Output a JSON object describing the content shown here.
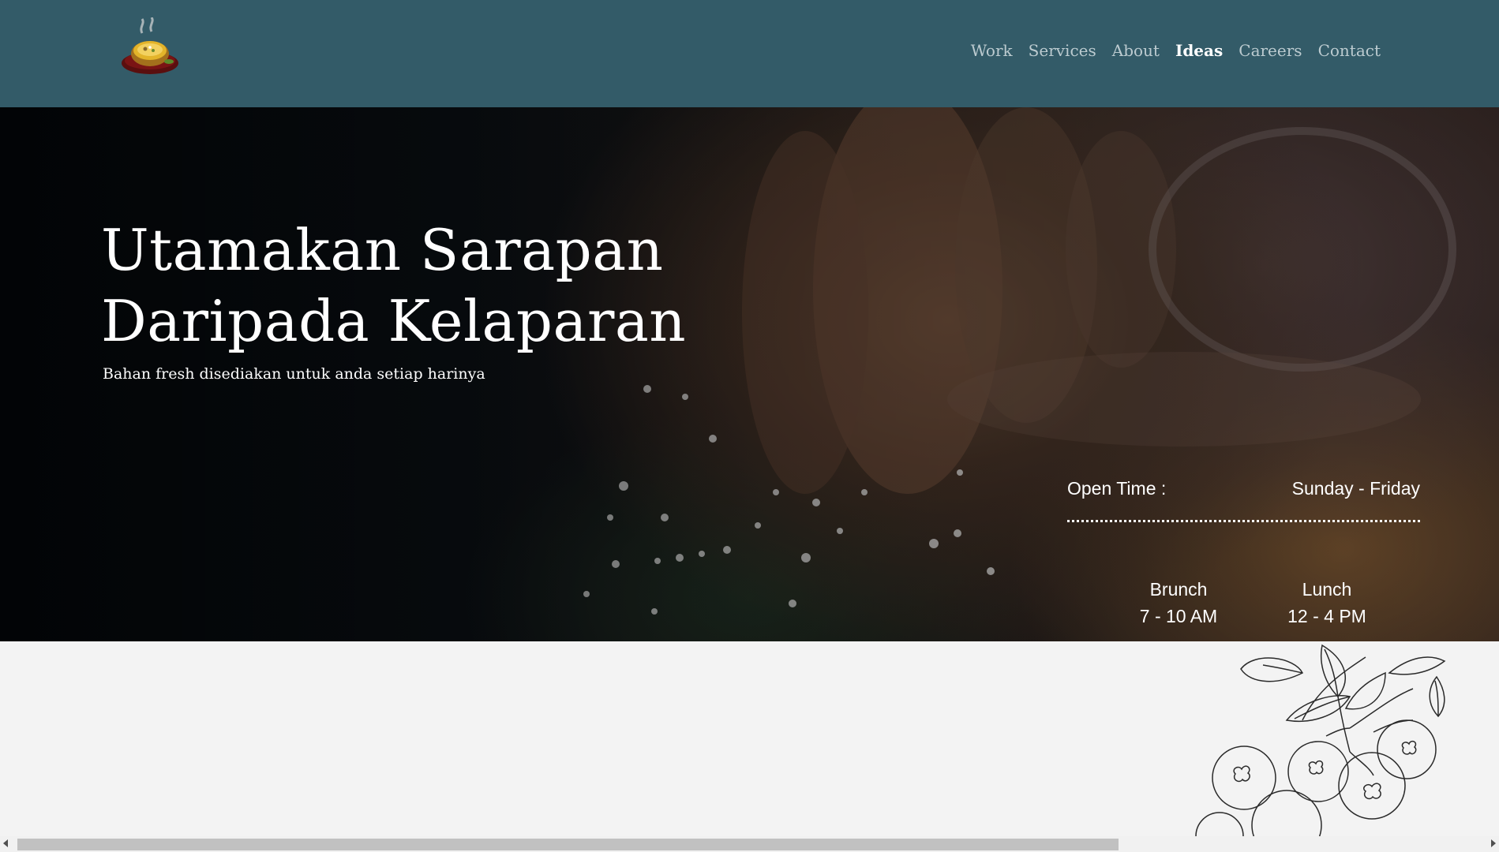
{
  "nav": {
    "items": [
      {
        "label": "Work",
        "active": false
      },
      {
        "label": "Services",
        "active": false
      },
      {
        "label": "About",
        "active": false
      },
      {
        "label": "Ideas",
        "active": true
      },
      {
        "label": "Careers",
        "active": false
      },
      {
        "label": "Contact",
        "active": false
      }
    ]
  },
  "hero": {
    "title_line1": "Utamakan Sarapan",
    "title_line2": "Daripada Kelaparan",
    "subtitle": "Bahan fresh disediakan untuk anda setiap harinya"
  },
  "hours": {
    "label": "Open Time :",
    "days": "Sunday - Friday",
    "meals": [
      {
        "name": "Brunch",
        "time": "7 - 10 AM"
      },
      {
        "name": "Lunch",
        "time": "12 - 4 PM"
      }
    ]
  },
  "colors": {
    "header_bg": "#335b68",
    "nav_text": "#bccbd0",
    "nav_active": "#ffffff",
    "page_bg": "#f3f3f3"
  }
}
